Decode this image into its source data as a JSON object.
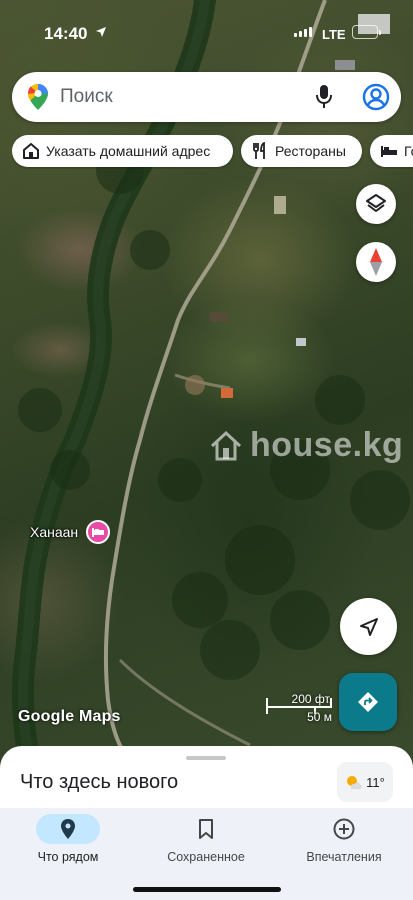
{
  "status_bar": {
    "time": "14:40",
    "network": "LTE",
    "battery_level": 0.25
  },
  "search": {
    "placeholder": "Поиск"
  },
  "chips": [
    {
      "icon": "home-icon",
      "label": "Указать домашний адрес"
    },
    {
      "icon": "restaurant-icon",
      "label": "Рестораны"
    },
    {
      "icon": "hotel-icon",
      "label": "Го"
    }
  ],
  "map": {
    "watermark": "house.kg",
    "place_label": "Ханаан",
    "logo": "Google Maps",
    "scale": {
      "imperial": "200 фт.",
      "metric": "50 м"
    }
  },
  "sheet": {
    "title": "Что здесь нового",
    "weather": {
      "temp": "11°",
      "icon": "partly-cloudy-icon"
    }
  },
  "nav": [
    {
      "label": "Что рядом",
      "icon": "location-pin-icon",
      "active": true
    },
    {
      "label": "Сохраненное",
      "icon": "bookmark-icon",
      "active": false
    },
    {
      "label": "Впечатления",
      "icon": "add-circle-icon",
      "active": false
    }
  ],
  "colors": {
    "accent": "#1a73e8",
    "nav_active": "#c2e7ff",
    "directions": "#0b7a8a",
    "hotel_pin": "#e94aa6"
  }
}
